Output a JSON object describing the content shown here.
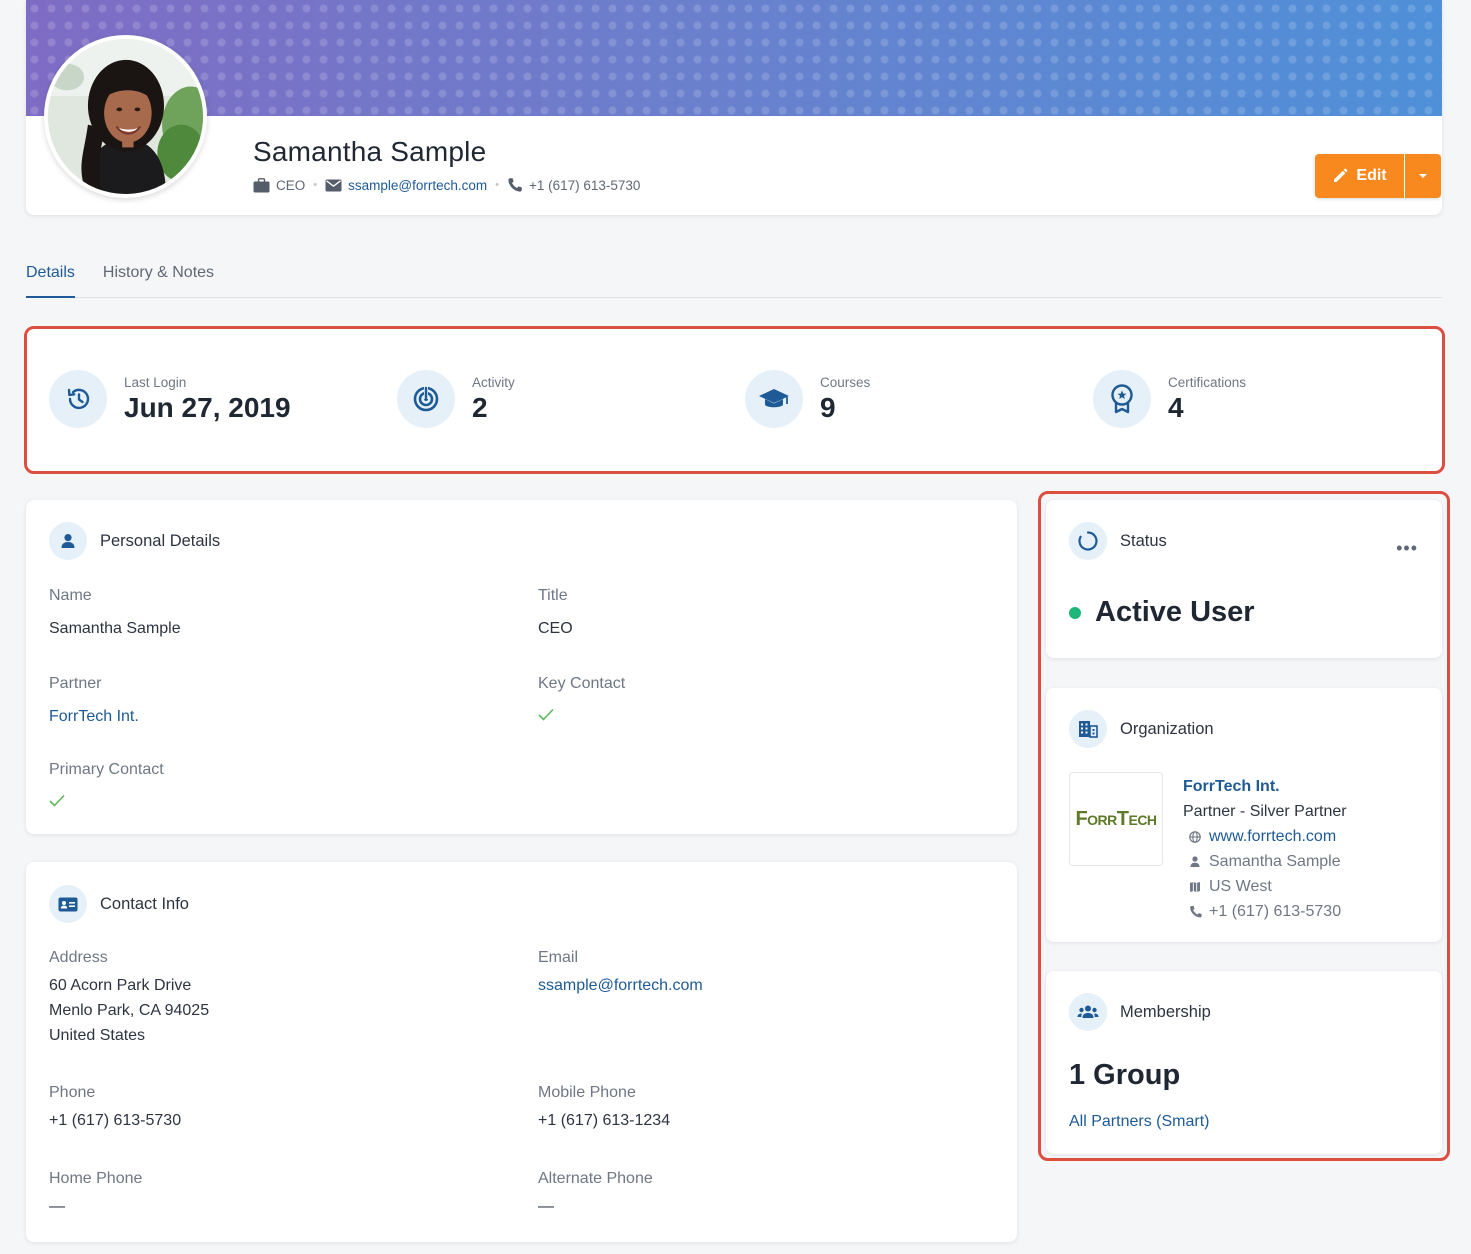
{
  "profile": {
    "name": "Samantha Sample",
    "title": "CEO",
    "email": "ssample@forrtech.com",
    "phone": "+1 (617) 613-5730",
    "edit_label": "Edit"
  },
  "tabs": [
    {
      "label": "Details",
      "active": true
    },
    {
      "label": "History & Notes",
      "active": false
    }
  ],
  "stats": [
    {
      "label": "Last Login",
      "value": "Jun 27, 2019",
      "icon": "history-icon"
    },
    {
      "label": "Activity",
      "value": "2",
      "icon": "activity-icon"
    },
    {
      "label": "Courses",
      "value": "9",
      "icon": "graduation-cap-icon"
    },
    {
      "label": "Certifications",
      "value": "4",
      "icon": "award-icon"
    }
  ],
  "personal": {
    "title": "Personal Details",
    "name_label": "Name",
    "name_value": "Samantha Sample",
    "title_label": "Title",
    "title_value": "CEO",
    "partner_label": "Partner",
    "partner_value": "ForrTech Int.",
    "key_contact_label": "Key Contact",
    "primary_contact_label": "Primary Contact"
  },
  "contact": {
    "title": "Contact Info",
    "address_label": "Address",
    "address_line1": "60 Acorn Park Drive",
    "address_line2": "Menlo Park, CA 94025",
    "address_line3": "United States",
    "email_label": "Email",
    "email_value": "ssample@forrtech.com",
    "phone_label": "Phone",
    "phone_value": "+1 (617) 613-5730",
    "mobile_label": "Mobile Phone",
    "mobile_value": "+1 (617) 613-1234",
    "home_label": "Home Phone",
    "home_value": "—",
    "alternate_label": "Alternate Phone",
    "alternate_value": "—"
  },
  "status": {
    "title": "Status",
    "value": "Active User",
    "more": "•••",
    "color": "#1fb67a"
  },
  "organization": {
    "title": "Organization",
    "logo_text": "ForrTech",
    "name": "ForrTech Int.",
    "type": "Partner - Silver Partner",
    "website": "www.forrtech.com",
    "contact": "Samantha Sample",
    "region": "US West",
    "phone": "+1 (617) 613-5730"
  },
  "membership": {
    "title": "Membership",
    "value": "1 Group",
    "group_link": "All Partners (Smart)"
  },
  "colors": {
    "accent": "#f7891f",
    "link": "#1e5a96",
    "highlight": "#dc4e3f",
    "check": "#5cb85c"
  }
}
